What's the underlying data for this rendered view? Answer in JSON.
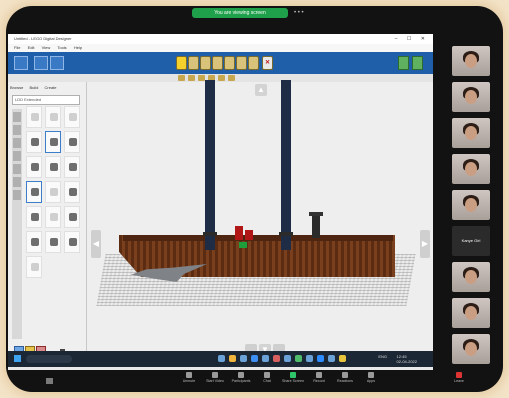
{
  "meeting": {
    "talking_banner": "You are viewing screen",
    "top_dots": "• • •",
    "participant_name_label": "Kanye Girl",
    "controls": [
      {
        "label": "Unmute",
        "icon": "microphone-icon"
      },
      {
        "label": "Start Video",
        "icon": "video-icon"
      },
      {
        "label": "Participants",
        "icon": "participants-icon"
      },
      {
        "label": "Chat",
        "icon": "chat-icon"
      },
      {
        "label": "Share Screen",
        "icon": "share-screen-icon"
      },
      {
        "label": "Record",
        "icon": "record-icon"
      },
      {
        "label": "Reactions",
        "icon": "reactions-icon"
      },
      {
        "label": "Apps",
        "icon": "apps-icon"
      },
      {
        "label": "Leave",
        "icon": "leave-icon"
      }
    ]
  },
  "app": {
    "title": "Untitled - LEGO Digital Designer",
    "window_controls": "– ☐ ✕",
    "menu": [
      "File",
      "Edit",
      "View",
      "Tools",
      "Help"
    ],
    "palette_tabs": [
      "Browse",
      "Build",
      "Create"
    ],
    "search_placeholder": "LDD Extended",
    "status_text": "0 bricks",
    "toolbar_icon": "tool-icons",
    "accent": "#1f5ea8"
  },
  "taskbar": {
    "time": "12:45",
    "date": "02-04-2022",
    "lang": "ENG"
  },
  "icons": {
    "up": "▲",
    "down": "▼",
    "left": "◀",
    "right": "▶",
    "delete": "✕"
  }
}
